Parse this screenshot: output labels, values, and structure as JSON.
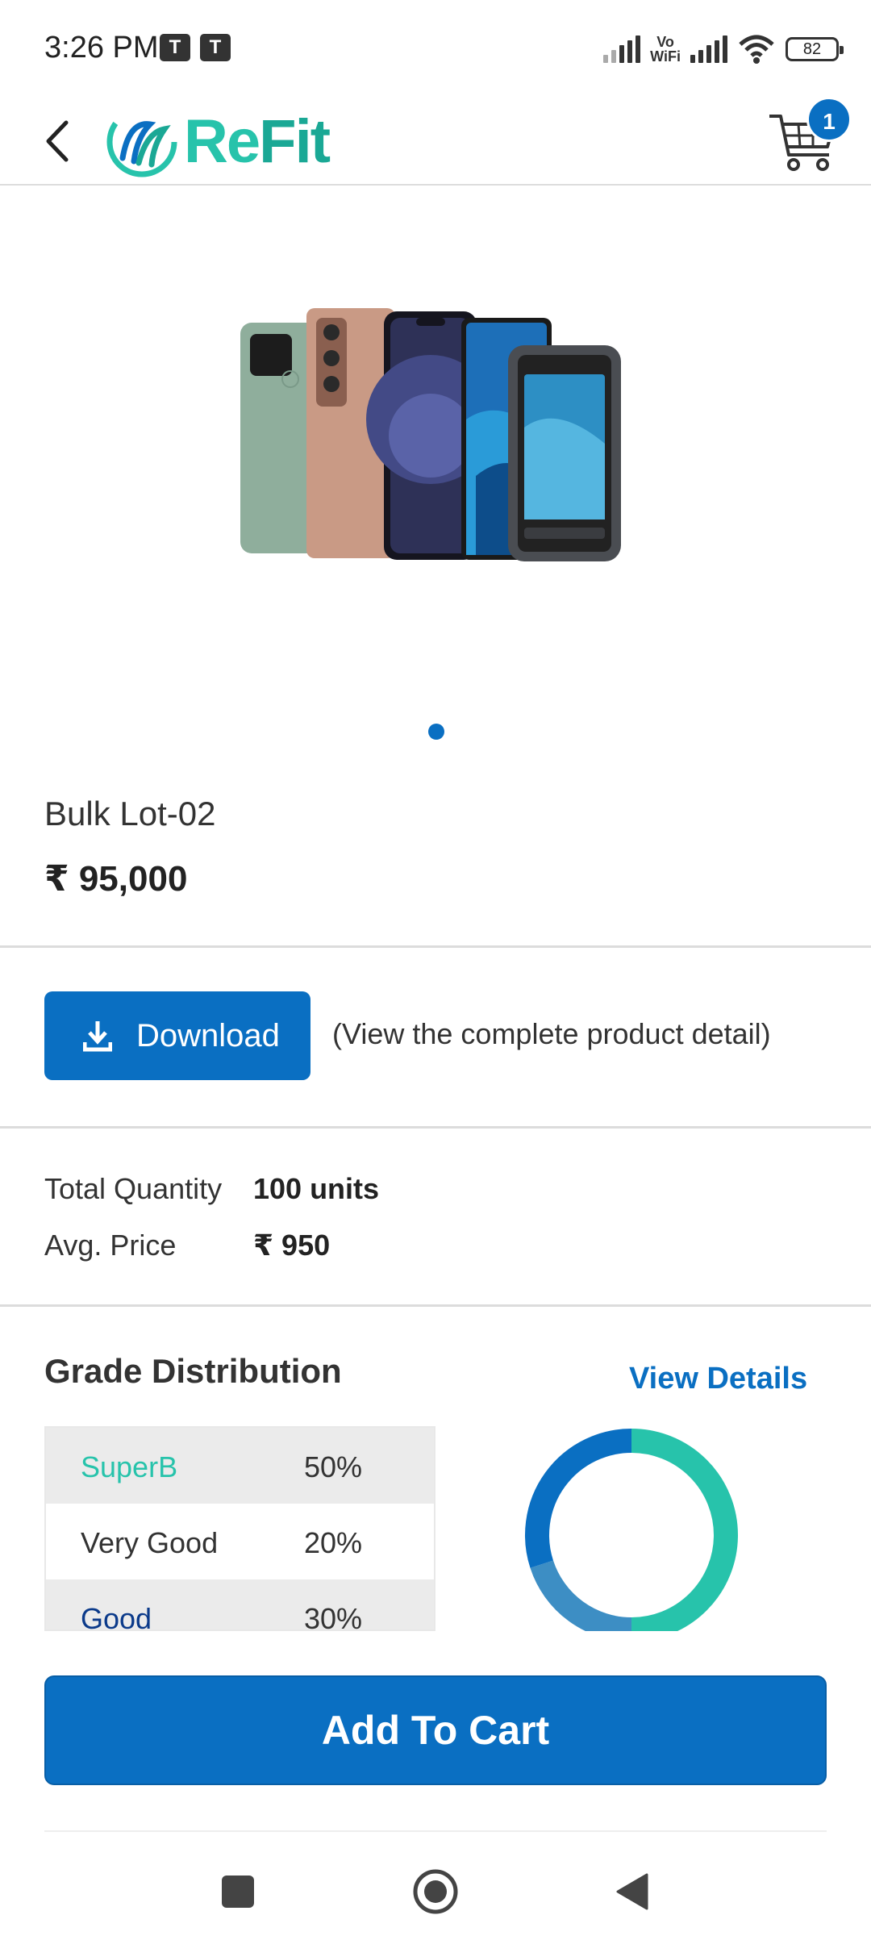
{
  "status_bar": {
    "time": "3:26 PM",
    "teams_icon_label": "T",
    "vowifi_line1": "Vo",
    "vowifi_line2": "WiFi",
    "battery": "82"
  },
  "header": {
    "logo_text_a": "Re",
    "logo_text_b": "Fit",
    "cart_count": "1"
  },
  "product": {
    "name": "Bulk Lot-02",
    "price": "₹ 95,000",
    "image_icon": "phones-image"
  },
  "download": {
    "label": "Download",
    "note": "(View the complete product detail)"
  },
  "summary": {
    "quantity_label": "Total Quantity",
    "quantity_value": "100 units",
    "avg_label": "Avg. Price",
    "avg_value": "₹ 950"
  },
  "grades": {
    "title": "Grade Distribution",
    "view_details": "View Details",
    "rows": [
      {
        "name": "SuperB",
        "pct": "50%",
        "color": "#27c3ab"
      },
      {
        "name": "Very Good",
        "pct": "20%",
        "color": "#333333"
      },
      {
        "name": "Good",
        "pct": "30%",
        "color": "#0b3a8a"
      }
    ]
  },
  "chart_data": {
    "type": "pie",
    "categories": [
      "SuperB",
      "Very Good",
      "Good"
    ],
    "values": [
      50,
      20,
      30
    ],
    "colors": [
      "#27c3ab",
      "#3d8ec4",
      "#0a6fc2"
    ],
    "donut": true
  },
  "actions": {
    "add_to_cart": "Add To Cart"
  },
  "colors": {
    "primary": "#0a6fc2",
    "brand": "#27c3ab"
  }
}
